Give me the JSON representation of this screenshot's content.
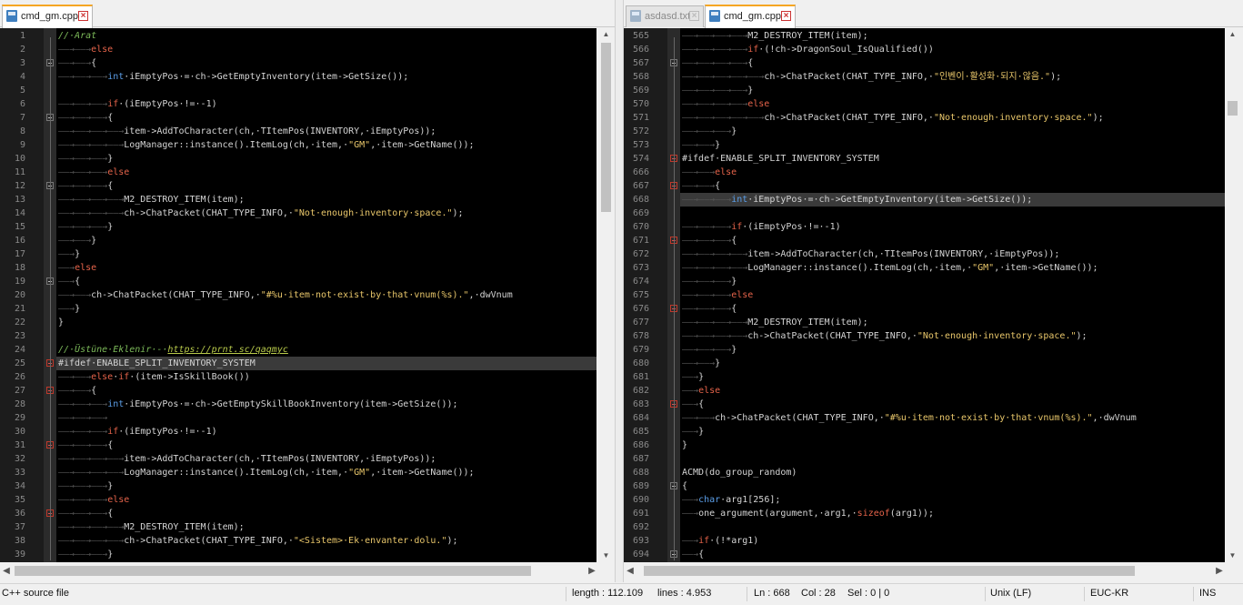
{
  "colors": {
    "keyword": "#e5634a",
    "type": "#5b9ee8",
    "string": "#e8c66a",
    "comment": "#7dbb5a",
    "func": "#d4d4d4",
    "preproc": "#d4d4d4",
    "tab_active_accent": "#f5a623",
    "close_icon": "#cc3333",
    "fold_red": "#c0392b",
    "link": "#b7c94a"
  },
  "left_pane": {
    "tabs": [
      {
        "label": "cmd_gm.cpp",
        "active": true,
        "icon": "file-icon"
      }
    ],
    "highlight_line": 25,
    "lines": [
      {
        "n": "1",
        "text": "//·Arat"
      },
      {
        "n": "2",
        "text": "——→——→else"
      },
      {
        "n": "3",
        "text": "——→——→{"
      },
      {
        "n": "4",
        "text": "——→——→——→int·iEmptyPos·=·ch->GetEmptyInventory(item->GetSize());"
      },
      {
        "n": "5",
        "text": ""
      },
      {
        "n": "6",
        "text": "——→——→——→if·(iEmptyPos·!=·-1)"
      },
      {
        "n": "7",
        "text": "——→——→——→{"
      },
      {
        "n": "8",
        "text": "——→——→——→——→item->AddToCharacter(ch,·TItemPos(INVENTORY,·iEmptyPos));"
      },
      {
        "n": "9",
        "text": "——→——→——→——→LogManager::instance().ItemLog(ch,·item,·\"GM\",·item->GetName());"
      },
      {
        "n": "10",
        "text": "——→——→——→}"
      },
      {
        "n": "11",
        "text": "——→——→——→else"
      },
      {
        "n": "12",
        "text": "——→——→——→{"
      },
      {
        "n": "13",
        "text": "——→——→——→——→M2_DESTROY_ITEM(item);"
      },
      {
        "n": "14",
        "text": "——→——→——→——→ch->ChatPacket(CHAT_TYPE_INFO,·\"Not·enough·inventory·space.\");"
      },
      {
        "n": "15",
        "text": "——→——→——→}"
      },
      {
        "n": "16",
        "text": "——→——→}"
      },
      {
        "n": "17",
        "text": "——→}"
      },
      {
        "n": "18",
        "text": "——→else"
      },
      {
        "n": "19",
        "text": "——→{"
      },
      {
        "n": "20",
        "text": "——→——→ch->ChatPacket(CHAT_TYPE_INFO,·\"#%u·item·not·exist·by·that·vnum(%s).\",·dwVnum"
      },
      {
        "n": "21",
        "text": "——→}"
      },
      {
        "n": "22",
        "text": "}"
      },
      {
        "n": "23",
        "text": ""
      },
      {
        "n": "24",
        "text": "//·Üstüne·Eklenir·-·https://prnt.sc/qaqmyc"
      },
      {
        "n": "25",
        "text": "#ifdef·ENABLE_SPLIT_INVENTORY_SYSTEM"
      },
      {
        "n": "26",
        "text": "——→——→else·if·(item->IsSkillBook())"
      },
      {
        "n": "27",
        "text": "——→——→{"
      },
      {
        "n": "28",
        "text": "——→——→——→int·iEmptyPos·=·ch->GetEmptySkillBookInventory(item->GetSize());"
      },
      {
        "n": "29",
        "text": "——→——→——→"
      },
      {
        "n": "30",
        "text": "——→——→——→if·(iEmptyPos·!=·-1)"
      },
      {
        "n": "31",
        "text": "——→——→——→{"
      },
      {
        "n": "32",
        "text": "——→——→——→——→item->AddToCharacter(ch,·TItemPos(INVENTORY,·iEmptyPos));"
      },
      {
        "n": "33",
        "text": "——→——→——→——→LogManager::instance().ItemLog(ch,·item,·\"GM\",·item->GetName());"
      },
      {
        "n": "34",
        "text": "——→——→——→}"
      },
      {
        "n": "35",
        "text": "——→——→——→else"
      },
      {
        "n": "36",
        "text": "——→——→——→{"
      },
      {
        "n": "37",
        "text": "——→——→——→——→M2_DESTROY_ITEM(item);"
      },
      {
        "n": "38",
        "text": "——→——→——→——→ch->ChatPacket(CHAT_TYPE_INFO,·\"<Sistem>·Ek·envanter·dolu.\");"
      },
      {
        "n": "39",
        "text": "——→——→——→}"
      }
    ]
  },
  "right_pane": {
    "tabs": [
      {
        "label": "asdasd.txt",
        "active": false,
        "icon": "file-icon"
      },
      {
        "label": "cmd_gm.cpp",
        "active": true,
        "icon": "file-icon"
      }
    ],
    "highlight_line": 668,
    "lines": [
      {
        "n": "565",
        "text": "——→——→——→——→M2_DESTROY_ITEM(item);"
      },
      {
        "n": "566",
        "text": "——→——→——→——→if·(!ch->DragonSoul_IsQualified())"
      },
      {
        "n": "567",
        "text": "——→——→——→——→{"
      },
      {
        "n": "568",
        "text": "——→——→——→——→——→ch->ChatPacket(CHAT_TYPE_INFO,·\"인벤이·활성화·되지·않음.\");"
      },
      {
        "n": "569",
        "text": "——→——→——→——→}"
      },
      {
        "n": "570",
        "text": "——→——→——→——→else"
      },
      {
        "n": "571",
        "text": "——→——→——→——→——→ch->ChatPacket(CHAT_TYPE_INFO,·\"Not·enough·inventory·space.\");"
      },
      {
        "n": "572",
        "text": "——→——→——→}"
      },
      {
        "n": "573",
        "text": "——→——→}"
      },
      {
        "n": "574",
        "text": "#ifdef·ENABLE_SPLIT_INVENTORY_SYSTEM"
      },
      {
        "n": "666",
        "text": "——→——→else"
      },
      {
        "n": "667",
        "text": "——→——→{"
      },
      {
        "n": "668",
        "text": "——→——→——→int·iEmptyPos·=·ch->GetEmptyInventory(item->GetSize());"
      },
      {
        "n": "669",
        "text": ""
      },
      {
        "n": "670",
        "text": "——→——→——→if·(iEmptyPos·!=·-1)"
      },
      {
        "n": "671",
        "text": "——→——→——→{"
      },
      {
        "n": "672",
        "text": "——→——→——→——→item->AddToCharacter(ch,·TItemPos(INVENTORY,·iEmptyPos));"
      },
      {
        "n": "673",
        "text": "——→——→——→——→LogManager::instance().ItemLog(ch,·item,·\"GM\",·item->GetName());"
      },
      {
        "n": "674",
        "text": "——→——→——→}"
      },
      {
        "n": "675",
        "text": "——→——→——→else"
      },
      {
        "n": "676",
        "text": "——→——→——→{"
      },
      {
        "n": "677",
        "text": "——→——→——→——→M2_DESTROY_ITEM(item);"
      },
      {
        "n": "678",
        "text": "——→——→——→——→ch->ChatPacket(CHAT_TYPE_INFO,·\"Not·enough·inventory·space.\");"
      },
      {
        "n": "679",
        "text": "——→——→——→}"
      },
      {
        "n": "680",
        "text": "——→——→}"
      },
      {
        "n": "681",
        "text": "——→}"
      },
      {
        "n": "682",
        "text": "——→else"
      },
      {
        "n": "683",
        "text": "——→{"
      },
      {
        "n": "684",
        "text": "——→——→ch->ChatPacket(CHAT_TYPE_INFO,·\"#%u·item·not·exist·by·that·vnum(%s).\",·dwVnum"
      },
      {
        "n": "685",
        "text": "——→}"
      },
      {
        "n": "686",
        "text": "}"
      },
      {
        "n": "687",
        "text": ""
      },
      {
        "n": "688",
        "text": "ACMD(do_group_random)"
      },
      {
        "n": "689",
        "text": "{"
      },
      {
        "n": "690",
        "text": "——→char·arg1[256];"
      },
      {
        "n": "691",
        "text": "——→one_argument(argument,·arg1,·sizeof(arg1));"
      },
      {
        "n": "692",
        "text": ""
      },
      {
        "n": "693",
        "text": "——→if·(!*arg1)"
      },
      {
        "n": "694",
        "text": "——→{"
      }
    ]
  },
  "status": {
    "file_type": "C++ source file",
    "length": "length : 112.109",
    "lines": "lines : 4.953",
    "ln": "Ln : 668",
    "col": "Col : 28",
    "sel": "Sel : 0 | 0",
    "eol": "Unix (LF)",
    "encoding": "EUC-KR",
    "mode": "INS"
  }
}
